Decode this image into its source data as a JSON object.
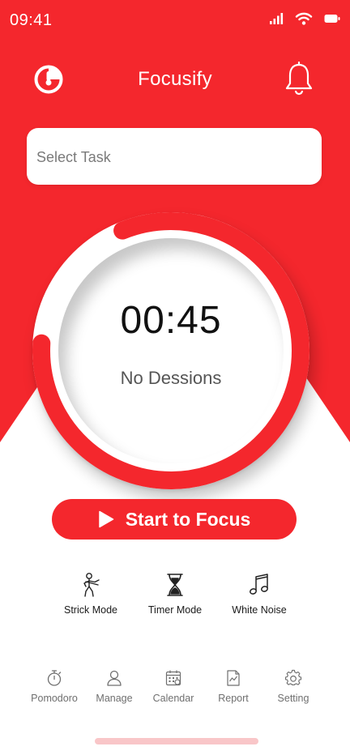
{
  "colors": {
    "brand_red": "#f4272d",
    "white": "#ffffff",
    "text_dark": "#1a1a1a",
    "text_grey": "#6f6f6f",
    "home_indicator": "#f9c6c8"
  },
  "status_bar": {
    "time": "09:41",
    "icons": [
      "signal-icon",
      "wifi-icon",
      "battery-icon"
    ]
  },
  "header": {
    "title": "Focusify",
    "left_icon": "logo-icon",
    "right_icon": "bell-icon"
  },
  "task_select": {
    "placeholder": "Select Task"
  },
  "timer": {
    "time": "00:45",
    "sessions_text": "No Dessions",
    "progress": 0.82
  },
  "start_button": {
    "label": "Start to Focus",
    "icon": "play-icon"
  },
  "modes": [
    {
      "label": "Strick Mode",
      "icon": "person-icon"
    },
    {
      "label": "Timer Mode",
      "icon": "hourglass-icon"
    },
    {
      "label": "White Noise",
      "icon": "music-note-icon"
    }
  ],
  "tabs": [
    {
      "label": "Pomodoro",
      "icon": "stopwatch-icon"
    },
    {
      "label": "Manage",
      "icon": "user-icon"
    },
    {
      "label": "Calendar",
      "icon": "calendar-icon"
    },
    {
      "label": "Report",
      "icon": "report-icon"
    },
    {
      "label": "Setting",
      "icon": "gear-icon"
    }
  ]
}
